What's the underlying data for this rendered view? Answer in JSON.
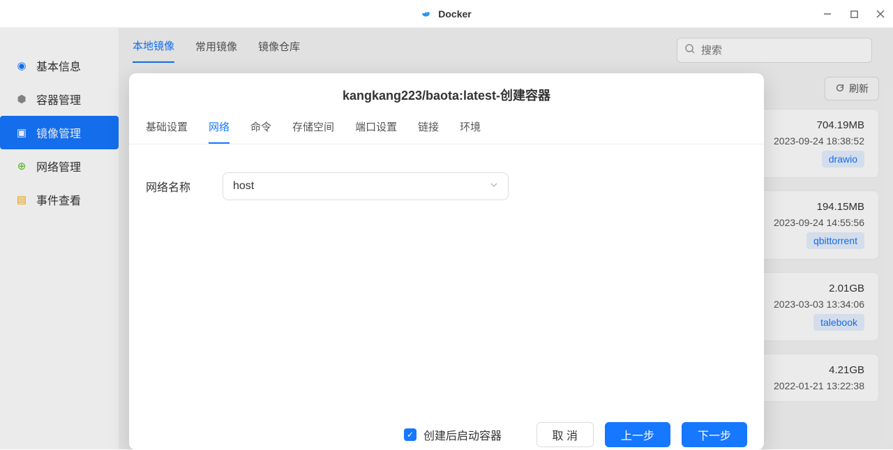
{
  "titlebar": {
    "app_name": "Docker"
  },
  "sidebar": {
    "items": [
      {
        "label": "基本信息",
        "icon": "info",
        "color": "#1677ff"
      },
      {
        "label": "容器管理",
        "icon": "cube",
        "color": "#8c8c8c"
      },
      {
        "label": "镜像管理",
        "icon": "layers",
        "color": "#fff",
        "active": true
      },
      {
        "label": "网络管理",
        "icon": "globe",
        "color": "#52c41a"
      },
      {
        "label": "事件查看",
        "icon": "list",
        "color": "#faad14"
      }
    ]
  },
  "main_tabs": [
    {
      "label": "本地镜像",
      "active": true
    },
    {
      "label": "常用镜像"
    },
    {
      "label": "镜像仓库"
    }
  ],
  "search": {
    "placeholder": "搜索"
  },
  "actions": {
    "refresh": "刷新"
  },
  "images": [
    {
      "size": "704.19MB",
      "date": "2023-09-24 18:38:52",
      "tag": "drawio"
    },
    {
      "size": "194.15MB",
      "date": "2023-09-24 14:55:56",
      "tag": "qbittorrent"
    },
    {
      "size": "2.01GB",
      "date": "2023-03-03 13:34:06",
      "tag": "talebook"
    },
    {
      "size": "4.21GB",
      "date": "2022-01-21 13:22:38",
      "tag": ""
    }
  ],
  "modal": {
    "title": "kangkang223/baota:latest-创建容器",
    "tabs": [
      {
        "label": "基础设置"
      },
      {
        "label": "网络",
        "active": true
      },
      {
        "label": "命令"
      },
      {
        "label": "存储空间"
      },
      {
        "label": "端口设置"
      },
      {
        "label": "链接"
      },
      {
        "label": "环境"
      }
    ],
    "form": {
      "network_name_label": "网络名称",
      "network_name_value": "host"
    },
    "footer": {
      "start_after_create": "创建后启动容器",
      "checked": true,
      "cancel": "取 消",
      "prev": "上一步",
      "next": "下一步"
    }
  }
}
